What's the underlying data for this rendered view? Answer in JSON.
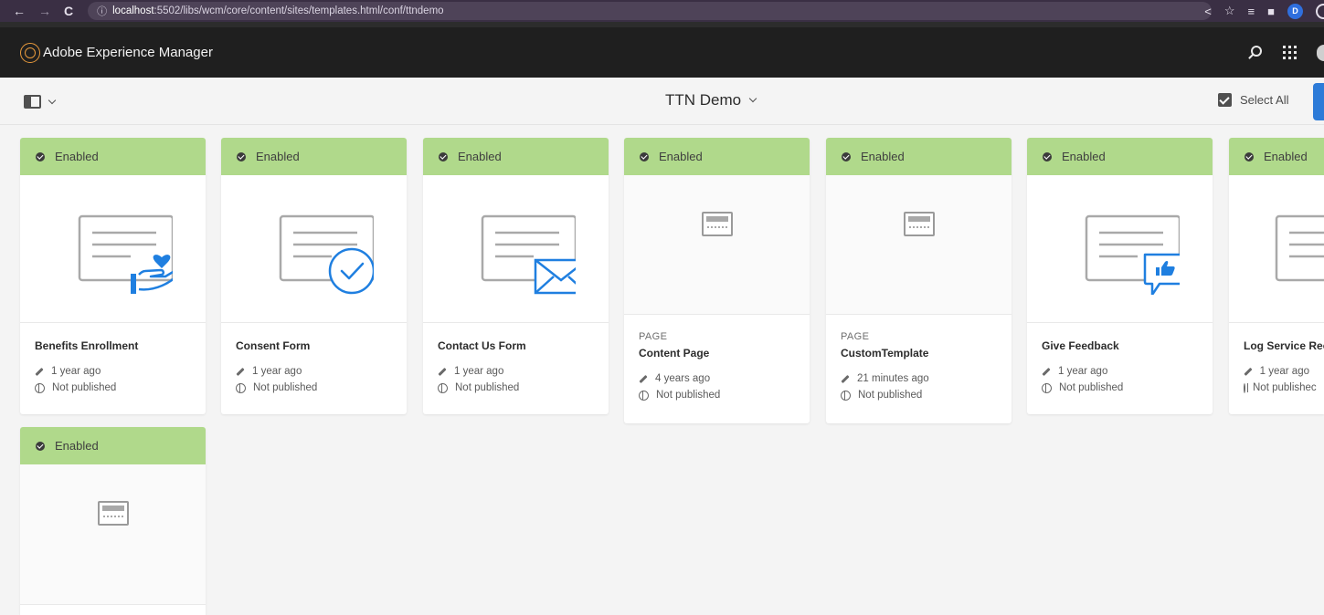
{
  "browser": {
    "url_host": "localhost",
    "url_rest": ":5502/libs/wcm/core/content/sites/templates.html/conf/ttndemo",
    "profile_initial": "D"
  },
  "header": {
    "app_title": "Adobe Experience Manager"
  },
  "toolbar": {
    "title": "TTN Demo",
    "select_all": "Select All"
  },
  "colors": {
    "status_enabled": "#b0d98b",
    "accent_blue": "#2d7bd8"
  },
  "cards": [
    {
      "status": "Enabled",
      "kind": "",
      "title": "Benefits Enrollment",
      "modified": "1 year ago",
      "published": "Not published",
      "thumbnail": "form-hand-heart-icon"
    },
    {
      "status": "Enabled",
      "kind": "",
      "title": "Consent Form",
      "modified": "1 year ago",
      "published": "Not published",
      "thumbnail": "form-check-circle-icon"
    },
    {
      "status": "Enabled",
      "kind": "",
      "title": "Contact Us Form",
      "modified": "1 year ago",
      "published": "Not published",
      "thumbnail": "form-envelope-icon"
    },
    {
      "status": "Enabled",
      "kind": "PAGE",
      "title": "Content Page",
      "modified": "4 years ago",
      "published": "Not published",
      "thumbnail": "page-template-icon"
    },
    {
      "status": "Enabled",
      "kind": "PAGE",
      "title": "CustomTemplate",
      "modified": "21 minutes ago",
      "published": "Not published",
      "thumbnail": "page-template-icon"
    },
    {
      "status": "Enabled",
      "kind": "",
      "title": "Give Feedback",
      "modified": "1 year ago",
      "published": "Not published",
      "thumbnail": "form-thumbs-up-icon"
    },
    {
      "status": "Enabled",
      "kind": "",
      "title": "Log Service Rec",
      "modified": "1 year ago",
      "published": "Not publishec",
      "thumbnail": "form-lines-icon"
    },
    {
      "status": "Enabled",
      "kind": "",
      "title": "",
      "modified": "",
      "published": "",
      "thumbnail": "page-template-icon"
    }
  ]
}
